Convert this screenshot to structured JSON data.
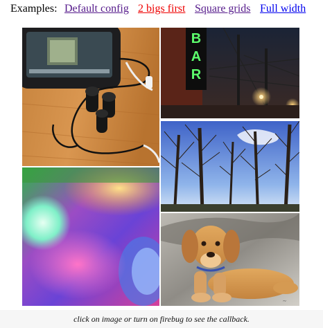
{
  "nav": {
    "label": "Examples:",
    "links": [
      {
        "label": "Default config"
      },
      {
        "label": "2 bigs first"
      },
      {
        "label": "Square grids"
      },
      {
        "label": "Full width"
      }
    ]
  },
  "tiles": [
    {
      "icon": "earphones-phone-photo"
    },
    {
      "icon": "bar-neon-sign-photo",
      "sign_text": "BAR"
    },
    {
      "icon": "bare-trees-sky-photo"
    },
    {
      "icon": "colorful-bokeh-photo"
    },
    {
      "icon": "puppy-photo"
    }
  ],
  "caption": "click on image or turn on firebug to see the callback."
}
